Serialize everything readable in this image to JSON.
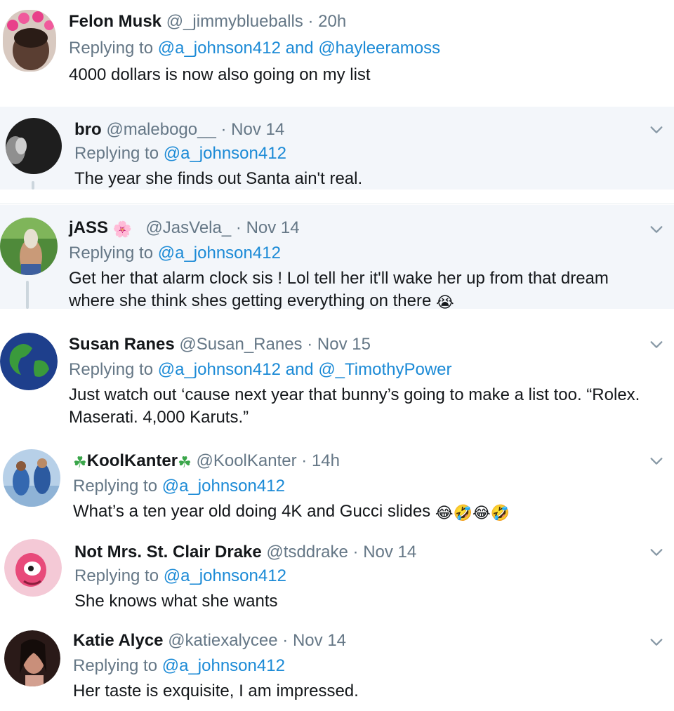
{
  "replies": [
    {
      "name": "Felon Musk",
      "handle": "@_jimmyblueballs",
      "time": "20h",
      "replying_prefix": "Replying to",
      "mention1": "@a_johnson412",
      "and_text": "and",
      "mention2": "@hayleeramoss",
      "text": "4000 dollars is now also going on my list"
    },
    {
      "name": "bro",
      "handle": "@malebogo__",
      "time": "Nov 14",
      "replying_prefix": "Replying to",
      "mention1": "@a_johnson412",
      "text": "The year she finds out Santa ain't real."
    },
    {
      "name": "jASS",
      "name_emoji": "🌸",
      "handle": "@JasVela_",
      "time": "Nov 14",
      "replying_prefix": "Replying to",
      "mention1": "@a_johnson412",
      "text_line1": "Get her that alarm clock sis ! Lol tell her it'll wake her up from that dream",
      "text_line2": "where she think shes getting everything on there",
      "text_emoji": "😭"
    },
    {
      "name": "Susan Ranes",
      "handle": "@Susan_Ranes",
      "time": "Nov 15",
      "replying_prefix": "Replying to",
      "mention1": "@a_johnson412",
      "and_text": "and",
      "mention2": "@_TimothyPower",
      "text_line1": "Just watch out ‘cause next year that bunny’s going to make a list too. “Rolex.",
      "text_line2": "Maserati. 4,000 Karuts.”"
    },
    {
      "name": "KoolKanter",
      "name_emoji": "☘",
      "handle": "@KoolKanter",
      "time": "14h",
      "replying_prefix": "Replying to",
      "mention1": "@a_johnson412",
      "text": "What’s a ten year old doing 4K and Gucci slides",
      "text_emojis": [
        "😂",
        "🤣",
        "😂",
        "🤣"
      ]
    },
    {
      "name": "Not Mrs. St. Clair Drake",
      "handle": "@tsddrake",
      "time": "Nov 14",
      "replying_prefix": "Replying to",
      "mention1": "@a_johnson412",
      "text": "She knows what she wants"
    },
    {
      "name": "Katie Alyce",
      "handle": "@katiexalycee",
      "time": "Nov 14",
      "replying_prefix": "Replying to",
      "mention1": "@a_johnson412",
      "text": "Her taste is exquisite, I am impressed."
    }
  ],
  "separator": "·",
  "icons": {
    "more": "chevron-down-icon"
  },
  "colors": {
    "link": "#1b8ad6",
    "muted": "#657786",
    "shade": "#f3f6fa"
  }
}
